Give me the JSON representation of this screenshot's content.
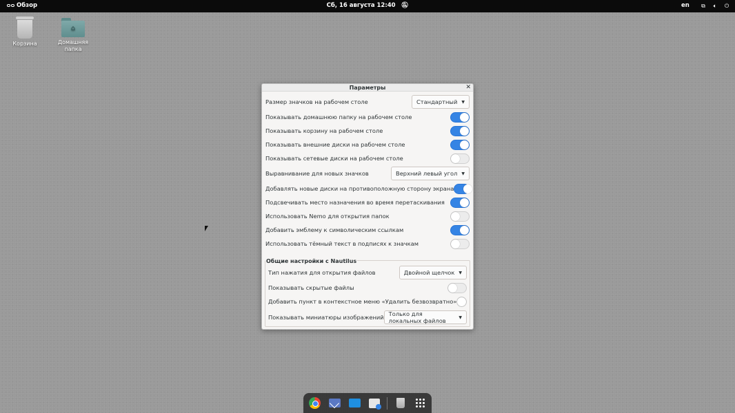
{
  "topbar": {
    "activities_label": "Обзор",
    "clock": "Сб, 16 августа  12:40",
    "language": "en"
  },
  "desktop": {
    "trash_label": "Корзина",
    "home_label": "Домашняя папка"
  },
  "dialog": {
    "title": "Параметры",
    "icon_size_label": "Размер значков на рабочем столе",
    "icon_size_value": "Стандартный",
    "show_home_label": "Показывать домашнюю папку на рабочем столе",
    "show_home_on": true,
    "show_trash_label": "Показывать корзину на рабочем столе",
    "show_trash_on": true,
    "show_external_label": "Показывать внешние диски на рабочем столе",
    "show_external_on": true,
    "show_network_label": "Показывать сетевые диски на рабочем столе",
    "show_network_on": false,
    "alignment_label": "Выравнивание для новых значков",
    "alignment_value": "Верхний левый угол",
    "add_opposite_label": "Добавлять новые диски на противоположную сторону экрана",
    "add_opposite_on": true,
    "highlight_drop_label": "Подсвечивать место назначения во время перетаскивания",
    "highlight_drop_on": true,
    "use_nemo_label": "Использовать Nemo для открытия папок",
    "use_nemo_on": false,
    "symlink_emblem_label": "Добавить эмблему к символическим ссылкам",
    "symlink_emblem_on": true,
    "dark_text_label": "Использовать тёмный текст в подписях к значкам",
    "dark_text_on": false,
    "nautilus_section": "Общие настройки с Nautilus",
    "click_type_label": "Тип нажатия для открытия файлов",
    "click_type_value": "Двойной щелчок",
    "show_hidden_label": "Показывать скрытые файлы",
    "show_hidden_on": false,
    "delete_permanently_label": "Добавить пункт в контекстное меню «Удалить безвозвратно»",
    "delete_permanently_on": false,
    "thumbnails_label": "Показывать миниатюры изображений",
    "thumbnails_value": "Только для локальных файлов"
  },
  "dock": {
    "apps": [
      "chrome-icon",
      "mail-icon",
      "files-icon",
      "software-icon",
      "trash-icon",
      "app-grid-icon"
    ]
  },
  "colors": {
    "accent": "#3584e4",
    "topbar": "#0b0b0b",
    "desktop": "#9a9a9a"
  }
}
